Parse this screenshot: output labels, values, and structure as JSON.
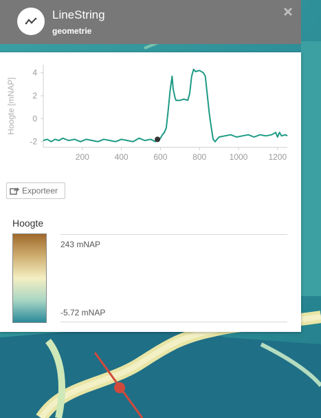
{
  "popup": {
    "title": "LineString",
    "subtitle": "geometrie",
    "export_label": "Exporteer"
  },
  "icons": {
    "geometry": "line-chart-icon",
    "close": "close-icon",
    "export": "share-icon"
  },
  "legend": {
    "title": "Hoogte",
    "max_label": "243 mNAP",
    "min_label": "-5.72 mNAP",
    "colors": [
      "#a0692c",
      "#cfae72",
      "#f4efc2",
      "#a9d6c4",
      "#2b8a9b"
    ]
  },
  "colors": {
    "line": "#1d9a85",
    "marker": "#333333",
    "map_water": "#2a8f97",
    "route": "#d04a3c"
  },
  "chart_data": {
    "type": "line",
    "title": "",
    "xlabel": "",
    "ylabel": "Hoogte [mNAP]",
    "xlim": [
      0,
      1250
    ],
    "ylim": [
      -2.5,
      4.7
    ],
    "x_ticks": [
      200,
      400,
      600,
      800,
      1000,
      1200
    ],
    "y_ticks": [
      -2,
      0,
      2,
      4
    ],
    "grid": false,
    "marker": {
      "x": 585,
      "y": -1.8
    },
    "series": [
      {
        "x": [
          0,
          20,
          40,
          60,
          80,
          100,
          130,
          160,
          190,
          220,
          250,
          280,
          310,
          340,
          370,
          400,
          430,
          460,
          490,
          520,
          550,
          575,
          590,
          600,
          610,
          620,
          630,
          640,
          650,
          660,
          665,
          675,
          680,
          700,
          720,
          740,
          750,
          760,
          770,
          780,
          800,
          820,
          830,
          850,
          860,
          870,
          880,
          900,
          930,
          960,
          990,
          1020,
          1050,
          1080,
          1110,
          1140,
          1170,
          1190,
          1200,
          1210,
          1220,
          1240,
          1250
        ],
        "y": [
          -1.9,
          -1.8,
          -2.0,
          -1.8,
          -1.9,
          -1.7,
          -1.9,
          -1.8,
          -2.0,
          -1.8,
          -1.9,
          -2.0,
          -1.8,
          -1.9,
          -2.0,
          -1.8,
          -1.9,
          -2.0,
          -1.7,
          -1.9,
          -1.8,
          -2.0,
          -1.8,
          -1.7,
          -1.4,
          -1.2,
          -0.8,
          0.8,
          2.5,
          3.7,
          2.6,
          1.8,
          1.6,
          1.6,
          1.7,
          1.6,
          2.2,
          3.7,
          4.3,
          4.1,
          4.2,
          4.0,
          3.7,
          0.5,
          -0.7,
          -1.8,
          -2.0,
          -1.6,
          -1.5,
          -1.4,
          -1.6,
          -1.5,
          -1.4,
          -1.6,
          -1.4,
          -1.5,
          -1.4,
          -1.2,
          -1.6,
          -1.2,
          -1.5,
          -1.4,
          -1.5
        ]
      }
    ]
  }
}
